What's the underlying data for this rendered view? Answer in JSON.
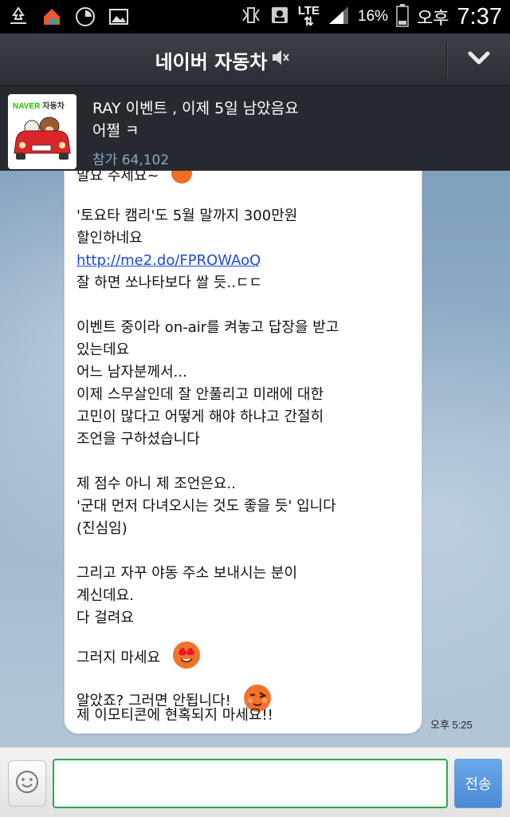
{
  "status_bar": {
    "network": "LTE",
    "battery": "16%",
    "ampm": "오후",
    "time": "7:37"
  },
  "header": {
    "title": "네이버 자동차",
    "mute_icon": "speaker-muted-icon",
    "collapse_icon": "chevron-down-icon"
  },
  "notice": {
    "thumb_naver": "NAVER",
    "thumb_label": "자동차",
    "line1": "RAY 이벤트 , 이제 5일 남았음요",
    "line2": "어쩔 ㅋ",
    "participants_label": "참가",
    "participants_count": "64,102"
  },
  "message": {
    "partial_top": "말요 주세요~",
    "p1_l1": "'토요타 캠리'도 5월 말까지 300만원",
    "p1_l2": "할인하네요",
    "p1_link": "http://me2.do/FPROWAoQ",
    "p1_l3": "잘 하면 쏘나타보다 쌀 듯..ㄷㄷ",
    "p2_l1": "이벤트 중이라 on-air를 켜놓고 답장을 받고",
    "p2_l2": "있는데요",
    "p2_l3": "어느 남자분께서...",
    "p2_l4": "이제 스무살인데 잘 안풀리고 미래에 대한",
    "p2_l5": "고민이 많다고 어떻게 해야 하냐고 간절히",
    "p2_l6": "조언을 구하셨습니다",
    "p3_l1": "제 점수 아니 제 조언은요..",
    "p3_l2": "'군대 먼저 다녀오시는 것도 좋을 듯'  입니다",
    "p3_l3": "(진심임)",
    "p4_l1": "그리고 자꾸 야동 주소 보내시는 분이",
    "p4_l2": "계신데요.",
    "p4_l3": "다 걸려요",
    "p5_l1": "그러지 마세요",
    "p6_l1": "알았죠? 그러면 안됩니다!",
    "p6_l2": "제 이모티콘에 현혹되지 마세요!!",
    "timestamp": "오후 5:25"
  },
  "input_bar": {
    "input_value": "",
    "send_label": "전송"
  },
  "colors": {
    "link": "#1d4bd6",
    "input_border": "#22b04a",
    "send_button": "#4a8ad4",
    "naver_green": "#1ec800"
  }
}
